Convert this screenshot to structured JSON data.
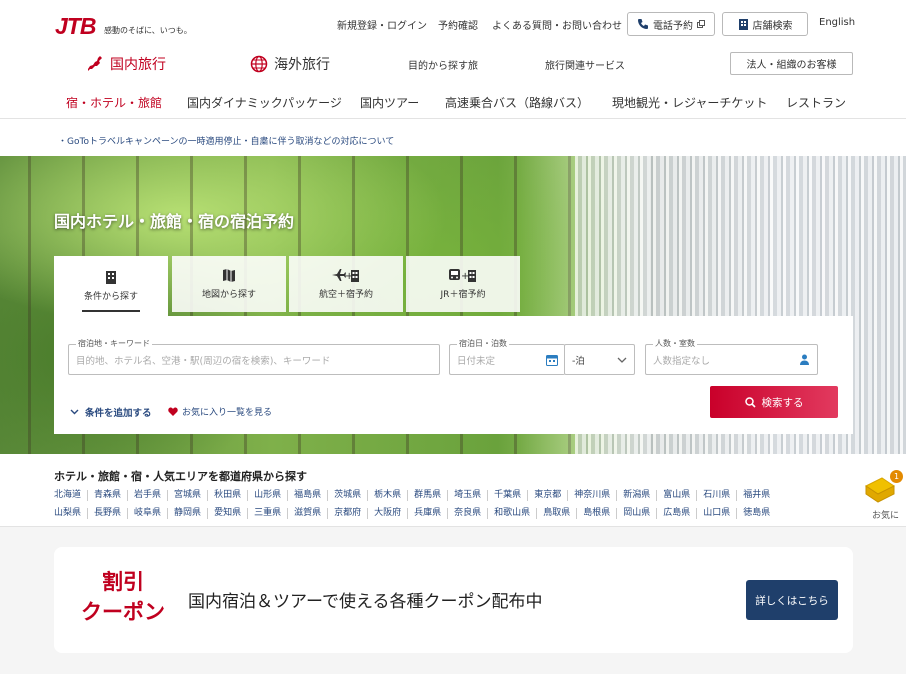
{
  "header": {
    "logo_text": "JTB",
    "tagline": "感動のそばに、いつも。",
    "top_links": [
      "新規登録・ログイン",
      "予約確認",
      "よくある質問・お問い合わせ"
    ],
    "phone_reservation": "電話予約",
    "store_search": "店舗検索",
    "language": "English",
    "main_tabs": {
      "domestic": "国内旅行",
      "overseas": "海外旅行"
    },
    "main_links": [
      "目的から探す旅",
      "旅行関連サービス"
    ],
    "corporate_button": "法人・組織のお客様"
  },
  "category_nav": [
    "宿・ホテル・旅館",
    "国内ダイナミックパッケージ",
    "国内ツアー",
    "高速乗合バス（路線バス）",
    "現地観光・レジャーチケット",
    "レストラン"
  ],
  "notice": "・GoToトラベルキャンペーンの一時適用停止・自粛に伴う取消などの対応について",
  "hero": {
    "title": "国内ホテル・旅館・宿の宿泊予約",
    "search_tabs": [
      "条件から探す",
      "地図から探す",
      "航空＋宿予約",
      "JR＋宿予約"
    ],
    "fields": {
      "destination_label": "宿泊地・キーワード",
      "destination_placeholder": "目的地、ホテル名、空港・駅(周辺の宿を検索)、キーワード",
      "date_label": "宿泊日・泊数",
      "date_placeholder": "日付未定",
      "nights_value": "-泊",
      "guests_label": "人数・室数",
      "guests_placeholder": "人数指定なし"
    },
    "search_button": "検索する",
    "add_conditions": "条件を追加する",
    "favorites_link": "お気に入り一覧を見る"
  },
  "prefectures": {
    "title": "ホテル・旅館・宿・人気エリアを都道府県から探す",
    "row1": [
      "北海道",
      "青森県",
      "岩手県",
      "宮城県",
      "秋田県",
      "山形県",
      "福島県",
      "茨城県",
      "栃木県",
      "群馬県",
      "埼玉県",
      "千葉県",
      "東京都",
      "神奈川県",
      "新潟県",
      "富山県",
      "石川県",
      "福井県"
    ],
    "row2": [
      "山梨県",
      "長野県",
      "岐阜県",
      "静岡県",
      "愛知県",
      "三重県",
      "滋賀県",
      "京都府",
      "大阪府",
      "兵庫県",
      "奈良県",
      "和歌山県",
      "鳥取県",
      "島根県",
      "岡山県",
      "広島県",
      "山口県",
      "徳島県"
    ]
  },
  "favorite_widget": {
    "label": "お気に",
    "count": "1"
  },
  "coupon": {
    "big_line1": "割引",
    "big_line2": "クーポン",
    "text": "国内宿泊＆ツアーで使える各種クーポン配布中",
    "button": "詳しくはこちら"
  },
  "colors": {
    "brand_red": "#c0001f",
    "navy": "#1f3f6b",
    "link_blue": "#2a4a7f"
  }
}
